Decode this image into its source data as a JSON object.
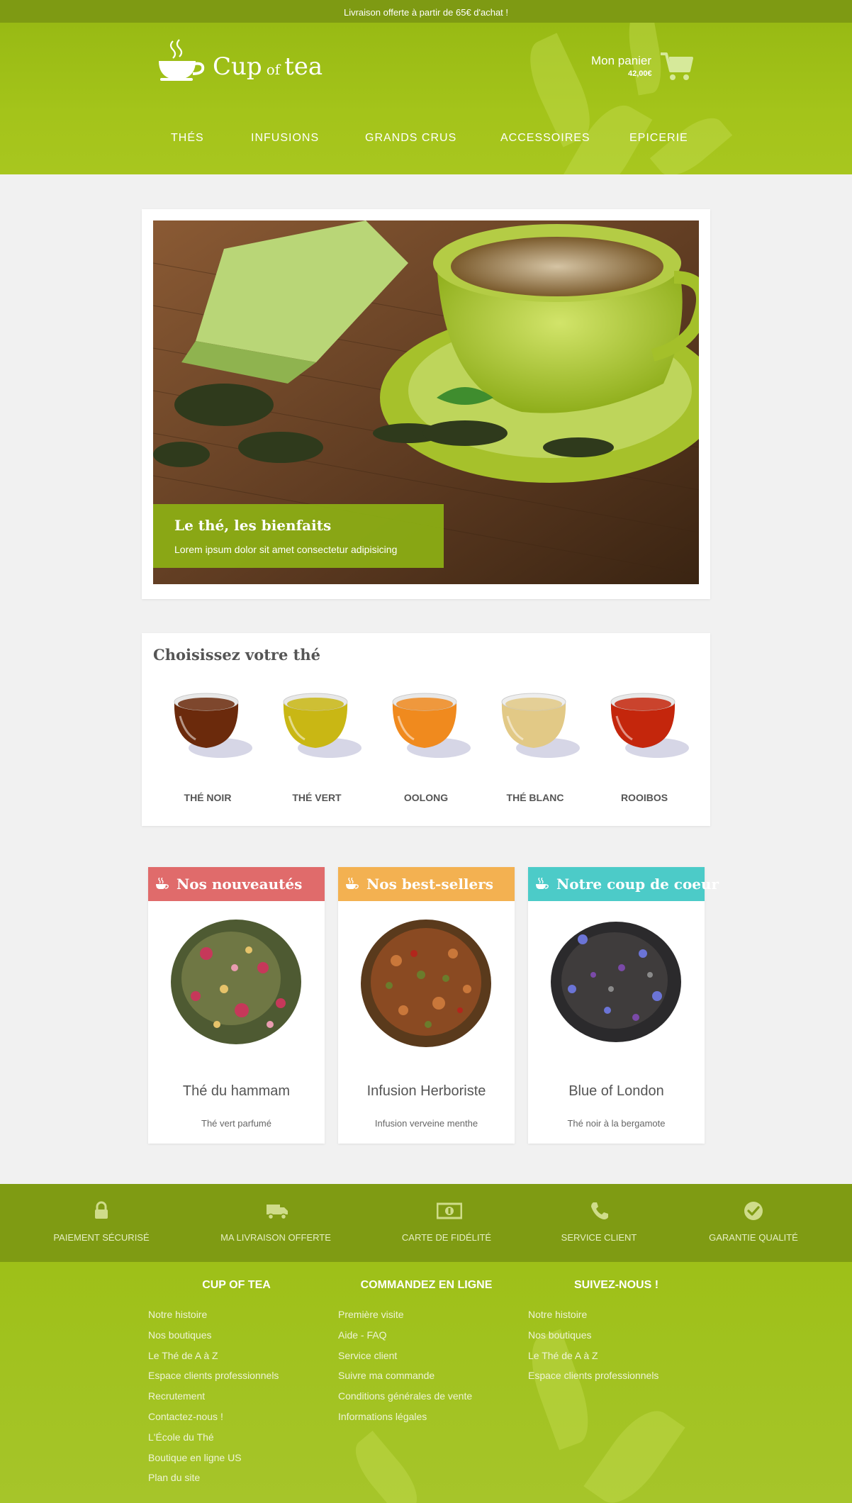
{
  "topbar": {
    "text": "Livraison offerte à partir de 65€ d'achat !"
  },
  "header": {
    "logo": {
      "cup": "Cup",
      "of": "of",
      "tea": "tea"
    },
    "cart": {
      "label": "Mon panier",
      "price": "42,00€",
      "icon": "cart-icon"
    },
    "nav": [
      "THÉS",
      "INFUSIONS",
      "GRANDS CRUS",
      "ACCESSOIRES",
      "EPICERIE"
    ]
  },
  "hero": {
    "title": "Le thé, les bienfaits",
    "subtitle": "Lorem ipsum dolor sit amet consectetur adipisicing"
  },
  "choose": {
    "title": "Choisissez votre thé",
    "teas": [
      {
        "label": "THÉ NOIR",
        "color": "#6b2a0c"
      },
      {
        "label": "THÉ VERT",
        "color": "#c9b714"
      },
      {
        "label": "OOLONG",
        "color": "#f08a1e"
      },
      {
        "label": "THÉ BLANC",
        "color": "#e2c986"
      },
      {
        "label": "ROOIBOS",
        "color": "#c4260c"
      }
    ]
  },
  "products": [
    {
      "header": "Nos nouveautés",
      "color": "#e06b6b",
      "title": "Thé du hammam",
      "subtitle": "Thé vert parfumé"
    },
    {
      "header": "Nos best-sellers",
      "color": "#f3b151",
      "title": "Infusion Herboriste",
      "subtitle": "Infusion verveine menthe"
    },
    {
      "header": "Notre coup de coeur",
      "color": "#4ccbc8",
      "title": "Blue of London",
      "subtitle": "Thé noir à la bergamote"
    }
  ],
  "features": [
    {
      "label": "PAIEMENT SÉCURISÉ",
      "icon": "lock-icon"
    },
    {
      "label": "MA LIVRAISON OFFERTE",
      "icon": "truck-icon"
    },
    {
      "label": "CARTE DE FIDÉLITÉ",
      "icon": "money-icon"
    },
    {
      "label": "SERVICE CLIENT",
      "icon": "phone-icon"
    },
    {
      "label": "GARANTIE QUALITÉ",
      "icon": "check-circle-icon"
    }
  ],
  "footer": {
    "columns": [
      {
        "title": "CUP OF TEA",
        "links": [
          "Notre histoire",
          "Nos boutiques",
          "Le Thé de A à Z",
          "Espace clients professionnels",
          "Recrutement",
          "Contactez-nous !",
          "L'École du Thé",
          "Boutique en ligne US",
          "Plan du site"
        ]
      },
      {
        "title": "COMMANDEZ EN LIGNE",
        "links": [
          "Première visite",
          "Aide - FAQ",
          "Service client",
          "Suivre ma commande",
          "Conditions générales de vente",
          "Informations légales"
        ]
      },
      {
        "title": "SUIVEZ-NOUS !",
        "links": [
          "Notre histoire",
          "Nos boutiques",
          "Le Thé de A à Z",
          "Espace clients professionnels"
        ]
      }
    ]
  }
}
